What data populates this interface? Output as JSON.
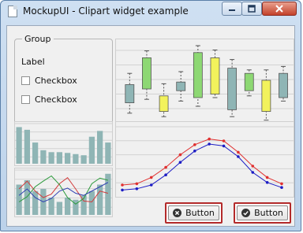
{
  "window": {
    "title": "MockupUI - Clipart widget example"
  },
  "group": {
    "title": "Group",
    "label": "Label",
    "checkboxes": [
      {
        "label": "Checkbox",
        "checked": false
      },
      {
        "label": "Checkbox",
        "checked": false
      }
    ]
  },
  "buttons": [
    {
      "label": "Button",
      "icon": "close-circle-icon"
    },
    {
      "label": "Button",
      "icon": "check-circle-icon"
    }
  ],
  "chart_data": [
    {
      "type": "boxplot",
      "boxes": [
        {
          "low": 0.22,
          "q1": 0.34,
          "q3": 0.55,
          "high": 0.68,
          "color": "#8fb5b5"
        },
        {
          "low": 0.38,
          "q1": 0.5,
          "q3": 0.86,
          "high": 0.94,
          "color": "#8dd873"
        },
        {
          "low": 0.18,
          "q1": 0.24,
          "q3": 0.42,
          "high": 0.56,
          "color": "#f2f25c"
        },
        {
          "low": 0.36,
          "q1": 0.48,
          "q3": 0.58,
          "high": 0.7,
          "color": "#8fb5b5"
        },
        {
          "low": 0.3,
          "q1": 0.4,
          "q3": 0.92,
          "high": 1.0,
          "color": "#8dd873"
        },
        {
          "low": 0.4,
          "q1": 0.44,
          "q3": 0.86,
          "high": 0.95,
          "color": "#f2f25c"
        },
        {
          "low": 0.18,
          "q1": 0.26,
          "q3": 0.74,
          "high": 0.84,
          "color": "#8fb5b5"
        },
        {
          "low": 0.42,
          "q1": 0.48,
          "q3": 0.68,
          "high": 0.72,
          "color": "#8dd873"
        },
        {
          "low": 0.14,
          "q1": 0.24,
          "q3": 0.6,
          "high": 0.72,
          "color": "#f2f25c"
        },
        {
          "low": 0.36,
          "q1": 0.4,
          "q3": 0.68,
          "high": 0.76,
          "color": "#8fb5b5"
        }
      ]
    },
    {
      "type": "bar",
      "values": [
        0.95,
        0.88,
        0.55,
        0.35,
        0.3,
        0.3,
        0.28,
        0.25,
        0.22,
        0.7,
        0.85,
        0.55
      ],
      "color": "#8fb5b5"
    },
    {
      "type": "bar-line",
      "values": [
        0.7,
        0.8,
        0.55,
        0.6,
        0.4,
        0.3,
        0.4,
        0.35,
        0.45,
        0.55,
        0.7,
        0.95
      ],
      "bar_color": "#8fb5b5",
      "series": [
        {
          "color": "#d23b3b",
          "values": [
            0.6,
            0.78,
            0.55,
            0.4,
            0.48,
            0.72,
            0.86,
            0.6,
            0.32,
            0.3,
            0.55,
            0.5
          ]
        },
        {
          "color": "#2b9a3b",
          "values": [
            0.3,
            0.42,
            0.65,
            0.78,
            0.9,
            0.7,
            0.4,
            0.25,
            0.38,
            0.72,
            0.85,
            0.8
          ]
        },
        {
          "color": "#2f3fb2",
          "values": [
            0.45,
            0.6,
            0.4,
            0.3,
            0.38,
            0.55,
            0.62,
            0.5,
            0.45,
            0.55,
            0.65,
            0.75
          ]
        }
      ]
    },
    {
      "type": "line",
      "series": [
        {
          "color": "#e03030",
          "values": [
            0.1,
            0.12,
            0.22,
            0.38,
            0.58,
            0.74,
            0.83,
            0.8,
            0.62,
            0.4,
            0.22,
            0.12
          ]
        },
        {
          "color": "#1c1cc4",
          "values": [
            0.02,
            0.04,
            0.1,
            0.26,
            0.46,
            0.64,
            0.75,
            0.72,
            0.55,
            0.3,
            0.14,
            0.06
          ]
        }
      ]
    }
  ]
}
